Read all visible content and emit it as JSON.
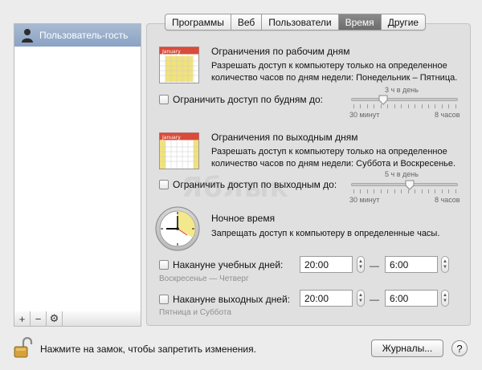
{
  "sidebar": {
    "items": [
      {
        "label": "Пользователь-гость",
        "icon": "user-silhouette-icon"
      }
    ],
    "toolbar": {
      "add": "+",
      "remove": "−",
      "actions": "⚙"
    }
  },
  "tabs": [
    {
      "label": "Программы",
      "active": false
    },
    {
      "label": "Веб",
      "active": false
    },
    {
      "label": "Пользователи",
      "active": false
    },
    {
      "label": "Время",
      "active": true
    },
    {
      "label": "Другие",
      "active": false
    }
  ],
  "weekday": {
    "title": "Ограничения по рабочим дням",
    "description": "Разрешать доступ к компьютеру только на определенное количество часов по дням недели: Понедельник – Пятница.",
    "checkbox_label": "Ограничить доступ по будням до:",
    "slider_value_label": "3 ч в день",
    "slider_min_label": "30 минут",
    "slider_max_label": "8 часов",
    "slider_fraction": 0.3,
    "calendar_month": "January"
  },
  "weekend": {
    "title": "Ограничения по выходным дням",
    "description": "Разрешать доступ к компьютеру только на определенное количество часов по дням недели: Суббота и Воскресенье.",
    "checkbox_label": "Ограничить доступ по выходным до:",
    "slider_value_label": "5 ч в день",
    "slider_min_label": "30 минут",
    "slider_max_label": "8 часов",
    "slider_fraction": 0.55,
    "calendar_month": "January"
  },
  "bedtime": {
    "title": "Ночное время",
    "description": "Запрещать доступ к компьютеру в определенные часы.",
    "school_nights": {
      "label": "Накануне учебных дней:",
      "from": "20:00",
      "to": "6:00",
      "days": "Воскресенье — Четверг"
    },
    "weekend_nights": {
      "label": "Накануне выходных дней:",
      "from": "20:00",
      "to": "6:00",
      "days": "Пятница и Суббота"
    },
    "dash": "—"
  },
  "footer": {
    "lock_text": "Нажмите на замок, чтобы запретить изменения.",
    "logs_button": "Журналы...",
    "help": "?"
  },
  "watermark": "Яблык",
  "colors": {
    "sidebar_selection": "#8fa6c6",
    "active_tab": "#777777",
    "calendar_red": "#d94b3a",
    "calendar_yellow": "#f2e27a"
  }
}
